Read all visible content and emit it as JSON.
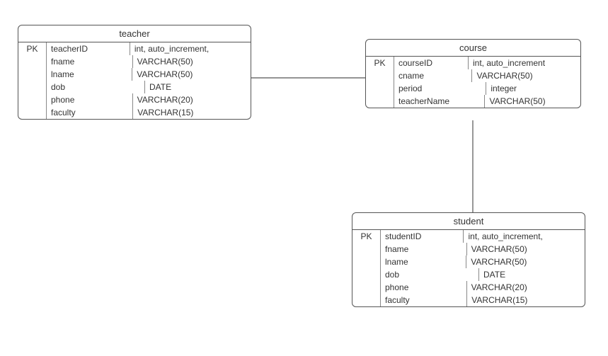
{
  "entities": {
    "teacher": {
      "title": "teacher",
      "rows": [
        {
          "pk": "PK",
          "name": "teacherID",
          "type": "int, auto_increment,"
        },
        {
          "pk": "",
          "name": "fname",
          "type": "VARCHAR(50)"
        },
        {
          "pk": "",
          "name": "lname",
          "type": "VARCHAR(50)"
        },
        {
          "pk": "",
          "name": "dob",
          "type": "DATE"
        },
        {
          "pk": "",
          "name": "phone",
          "type": "VARCHAR(20)"
        },
        {
          "pk": "",
          "name": "faculty",
          "type": "VARCHAR(15)"
        }
      ]
    },
    "course": {
      "title": "course",
      "rows": [
        {
          "pk": "PK",
          "name": "courseID",
          "type": "int, auto_increment"
        },
        {
          "pk": "",
          "name": "cname",
          "type": "VARCHAR(50)"
        },
        {
          "pk": "",
          "name": "period",
          "type": "integer"
        },
        {
          "pk": "",
          "name": "teacherName",
          "type": "VARCHAR(50)"
        }
      ]
    },
    "student": {
      "title": "student",
      "rows": [
        {
          "pk": "PK",
          "name": "studentID",
          "type": "int, auto_increment,"
        },
        {
          "pk": "",
          "name": "fname",
          "type": "VARCHAR(50)"
        },
        {
          "pk": "",
          "name": "lname",
          "type": "VARCHAR(50)"
        },
        {
          "pk": "",
          "name": "dob",
          "type": "DATE"
        },
        {
          "pk": "",
          "name": "phone",
          "type": "VARCHAR(20)"
        },
        {
          "pk": "",
          "name": "faculty",
          "type": "VARCHAR(15)"
        }
      ]
    }
  },
  "chart_data": {
    "type": "er-diagram",
    "entities": [
      "teacher",
      "course",
      "student"
    ],
    "relationships": [
      {
        "from": "teacher",
        "to": "course"
      },
      {
        "from": "course",
        "to": "student"
      }
    ]
  }
}
